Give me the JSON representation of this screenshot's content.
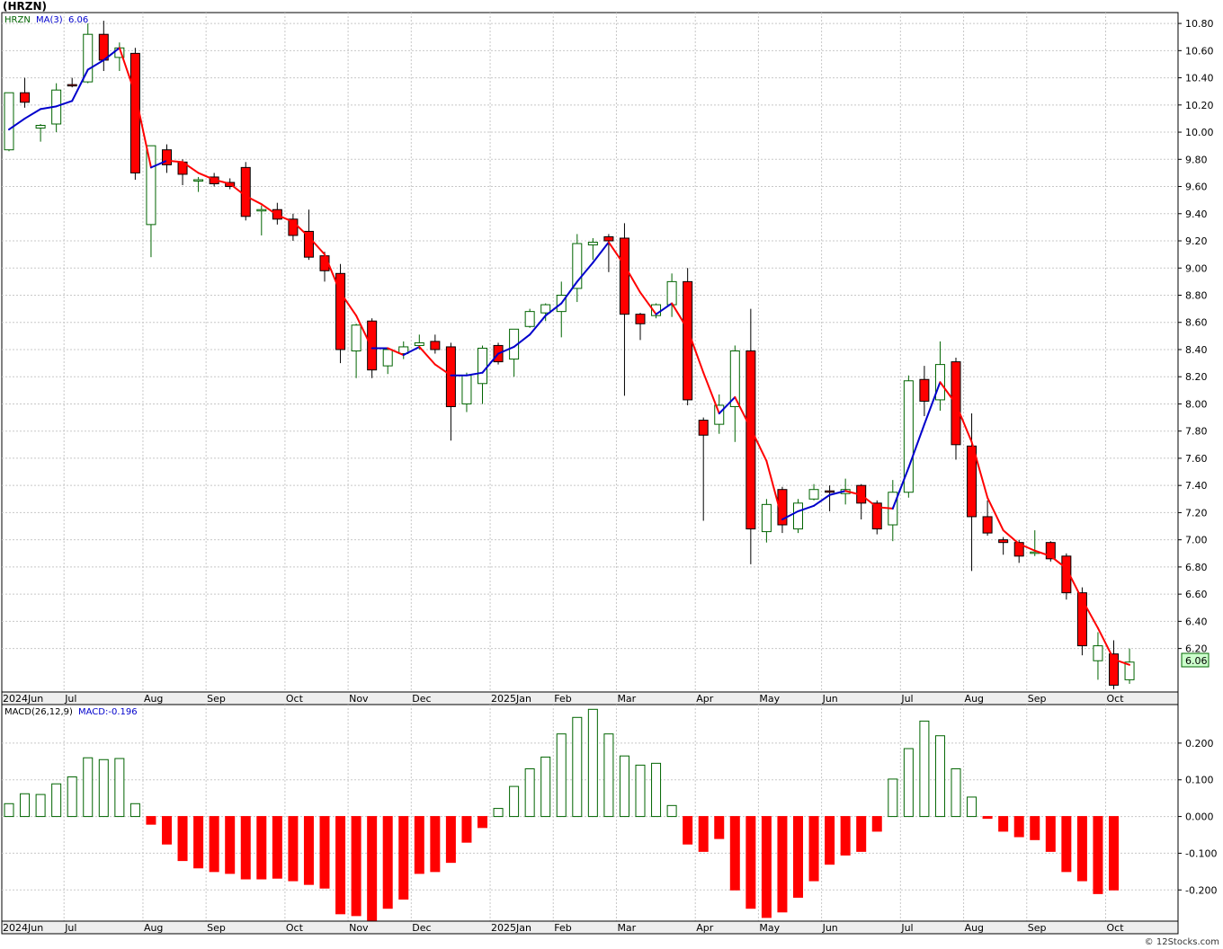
{
  "ticker_title": "(HRZN)",
  "watermark": "© 12Stocks.com",
  "colors": {
    "up_outline": "#006400",
    "down_fill": "#ff0000",
    "ma_up": "#0000cc",
    "ma_down": "#ff0000",
    "grid": "#c8c8c8",
    "last_price_box": "#ccffcc"
  },
  "chart_data": [
    {
      "type": "candlestick",
      "legend": {
        "symbol": "HRZN",
        "ma_label": "MA(3)",
        "ma_value": "6.06"
      },
      "last_price_label": "6.06",
      "ylim": [
        5.88,
        10.88
      ],
      "y_ticks": [
        "10.80",
        "10.60",
        "10.40",
        "10.20",
        "10.00",
        "9.80",
        "9.60",
        "9.40",
        "9.20",
        "9.00",
        "8.80",
        "8.60",
        "8.40",
        "8.20",
        "8.00",
        "7.80",
        "7.60",
        "7.40",
        "7.20",
        "7.00",
        "6.80",
        "6.60",
        "6.40",
        "6.20"
      ],
      "x_labels": [
        {
          "label": "2024Jun",
          "week": 0
        },
        {
          "label": "Jul",
          "week": 4
        },
        {
          "label": "Aug",
          "week": 9
        },
        {
          "label": "Sep",
          "week": 13
        },
        {
          "label": "Oct",
          "week": 18
        },
        {
          "label": "Nov",
          "week": 22
        },
        {
          "label": "Dec",
          "week": 26
        },
        {
          "label": "2025Jan",
          "week": 31
        },
        {
          "label": "Feb",
          "week": 35
        },
        {
          "label": "Mar",
          "week": 39
        },
        {
          "label": "Apr",
          "week": 44
        },
        {
          "label": "May",
          "week": 48
        },
        {
          "label": "Jun",
          "week": 52
        },
        {
          "label": "Jul",
          "week": 57
        },
        {
          "label": "Aug",
          "week": 61
        },
        {
          "label": "Sep",
          "week": 65
        },
        {
          "label": "Oct",
          "week": 70
        }
      ],
      "candles": [
        [
          9.87,
          10.29,
          9.86,
          10.29
        ],
        [
          10.29,
          10.4,
          10.18,
          10.22
        ],
        [
          10.03,
          10.06,
          9.93,
          10.05
        ],
        [
          10.06,
          10.36,
          10.0,
          10.31
        ],
        [
          10.35,
          10.4,
          10.33,
          10.34
        ],
        [
          10.37,
          10.8,
          10.36,
          10.72
        ],
        [
          10.72,
          10.82,
          10.45,
          10.53
        ],
        [
          10.55,
          10.66,
          10.45,
          10.62
        ],
        [
          10.58,
          10.62,
          9.65,
          9.7
        ],
        [
          9.32,
          9.9,
          9.08,
          9.9
        ],
        [
          9.87,
          9.91,
          9.7,
          9.76
        ],
        [
          9.78,
          9.8,
          9.61,
          9.69
        ],
        [
          9.64,
          9.67,
          9.56,
          9.65
        ],
        [
          9.67,
          9.7,
          9.6,
          9.62
        ],
        [
          9.63,
          9.66,
          9.58,
          9.6
        ],
        [
          9.74,
          9.78,
          9.35,
          9.38
        ],
        [
          9.43,
          9.46,
          9.24,
          9.43
        ],
        [
          9.43,
          9.48,
          9.32,
          9.36
        ],
        [
          9.36,
          9.4,
          9.2,
          9.24
        ],
        [
          9.27,
          9.43,
          9.06,
          9.08
        ],
        [
          9.09,
          9.12,
          8.9,
          8.98
        ],
        [
          8.96,
          9.03,
          8.3,
          8.4
        ],
        [
          8.39,
          8.59,
          8.19,
          8.58
        ],
        [
          8.61,
          8.63,
          8.19,
          8.25
        ],
        [
          8.28,
          8.41,
          8.22,
          8.4
        ],
        [
          8.37,
          8.46,
          8.33,
          8.42
        ],
        [
          8.43,
          8.51,
          8.4,
          8.45
        ],
        [
          8.46,
          8.51,
          8.37,
          8.4
        ],
        [
          8.42,
          8.45,
          7.73,
          7.98
        ],
        [
          8.0,
          8.23,
          7.94,
          8.21
        ],
        [
          8.15,
          8.43,
          8.0,
          8.41
        ],
        [
          8.43,
          8.45,
          8.29,
          8.31
        ],
        [
          8.33,
          8.55,
          8.2,
          8.55
        ],
        [
          8.57,
          8.7,
          8.56,
          8.68
        ],
        [
          8.67,
          8.74,
          8.61,
          8.73
        ],
        [
          8.68,
          8.9,
          8.49,
          8.8
        ],
        [
          8.85,
          9.25,
          8.75,
          9.18
        ],
        [
          9.17,
          9.22,
          9.06,
          9.19
        ],
        [
          9.23,
          9.25,
          8.97,
          9.2
        ],
        [
          9.22,
          9.33,
          8.06,
          8.66
        ],
        [
          8.66,
          8.67,
          8.47,
          8.59
        ],
        [
          8.65,
          8.74,
          8.63,
          8.73
        ],
        [
          8.73,
          8.96,
          8.64,
          8.9
        ],
        [
          8.9,
          9.0,
          7.99,
          8.03
        ],
        [
          7.88,
          7.9,
          7.14,
          7.77
        ],
        [
          7.85,
          8.07,
          7.78,
          7.99
        ],
        [
          7.98,
          8.43,
          7.72,
          8.39
        ],
        [
          8.39,
          8.7,
          6.82,
          7.08
        ],
        [
          7.06,
          7.3,
          6.98,
          7.26
        ],
        [
          7.37,
          7.39,
          7.05,
          7.11
        ],
        [
          7.08,
          7.3,
          7.05,
          7.27
        ],
        [
          7.3,
          7.41,
          7.29,
          7.37
        ],
        [
          7.36,
          7.4,
          7.21,
          7.35
        ],
        [
          7.34,
          7.45,
          7.26,
          7.37
        ],
        [
          7.4,
          7.41,
          7.15,
          7.27
        ],
        [
          7.27,
          7.29,
          7.04,
          7.08
        ],
        [
          7.11,
          7.44,
          6.99,
          7.35
        ],
        [
          7.35,
          8.21,
          7.31,
          8.17
        ],
        [
          8.18,
          8.28,
          7.91,
          8.02
        ],
        [
          8.03,
          8.46,
          7.95,
          8.29
        ],
        [
          8.31,
          8.34,
          7.59,
          7.7
        ],
        [
          7.69,
          7.93,
          6.77,
          7.17
        ],
        [
          7.17,
          7.29,
          7.03,
          7.05
        ],
        [
          7.0,
          7.02,
          6.89,
          6.98
        ],
        [
          6.98,
          7.0,
          6.83,
          6.88
        ],
        [
          6.9,
          7.07,
          6.88,
          6.91
        ],
        [
          6.98,
          6.99,
          6.84,
          6.86
        ],
        [
          6.88,
          6.9,
          6.56,
          6.61
        ],
        [
          6.61,
          6.65,
          6.15,
          6.22
        ],
        [
          6.11,
          6.32,
          5.97,
          6.22
        ],
        [
          6.16,
          6.26,
          5.9,
          5.93
        ],
        [
          5.97,
          6.2,
          5.94,
          6.1
        ]
      ],
      "ma": [
        10.02,
        10.1,
        10.17,
        10.19,
        10.23,
        10.46,
        10.53,
        10.62,
        10.28,
        9.74,
        9.79,
        9.78,
        9.7,
        9.65,
        9.62,
        9.53,
        9.47,
        9.39,
        9.34,
        9.23,
        9.1,
        8.82,
        8.65,
        8.41,
        8.41,
        8.36,
        8.42,
        8.29,
        8.21,
        8.21,
        8.23,
        8.37,
        8.42,
        8.51,
        8.65,
        8.74,
        8.9,
        9.04,
        9.19,
        9.02,
        8.82,
        8.66,
        8.74,
        8.55,
        8.23,
        7.93,
        8.05,
        7.82,
        7.58,
        7.15,
        7.21,
        7.25,
        7.33,
        7.36,
        7.33,
        7.24,
        7.23,
        7.53,
        7.85,
        8.16,
        8.0,
        7.72,
        7.31,
        7.07,
        6.97,
        6.92,
        6.88,
        6.79,
        6.56,
        6.35,
        6.12,
        6.08
      ]
    },
    {
      "type": "bar",
      "legend": {
        "indicator": "MACD(26,12,9)",
        "value_label": "MACD:-0.196"
      },
      "ylim": [
        -0.285,
        0.305
      ],
      "y_ticks": [
        "0.200",
        "0.100",
        "0.000",
        "-0.100",
        "-0.200"
      ],
      "values": [
        0.035,
        0.062,
        0.06,
        0.089,
        0.108,
        0.16,
        0.155,
        0.158,
        0.035,
        -0.021,
        -0.075,
        -0.12,
        -0.14,
        -0.15,
        -0.155,
        -0.17,
        -0.17,
        -0.168,
        -0.175,
        -0.185,
        -0.195,
        -0.265,
        -0.27,
        -0.285,
        -0.25,
        -0.225,
        -0.155,
        -0.15,
        -0.125,
        -0.07,
        -0.03,
        0.022,
        0.082,
        0.13,
        0.162,
        0.225,
        0.27,
        0.292,
        0.225,
        0.165,
        0.14,
        0.145,
        0.03,
        -0.075,
        -0.095,
        -0.06,
        -0.2,
        -0.25,
        -0.275,
        -0.26,
        -0.22,
        -0.175,
        -0.13,
        -0.105,
        -0.095,
        -0.04,
        0.102,
        0.185,
        0.26,
        0.22,
        0.13,
        0.053,
        -0.005,
        -0.04,
        -0.055,
        -0.063,
        -0.095,
        -0.15,
        -0.175,
        -0.21,
        -0.2
      ]
    }
  ]
}
